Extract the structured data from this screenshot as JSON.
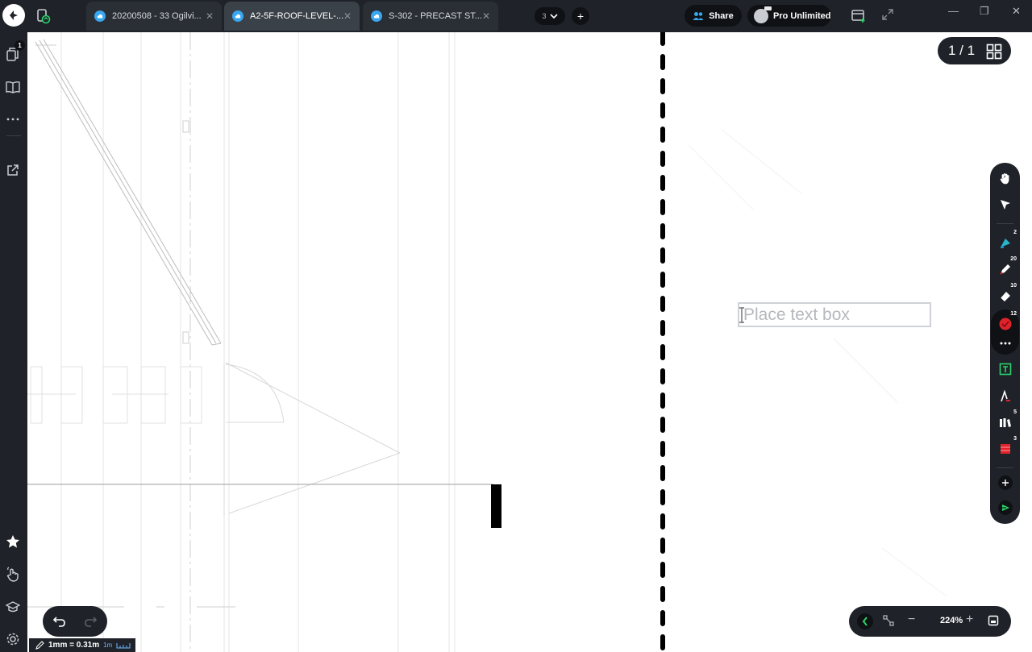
{
  "topbar": {
    "tabs": [
      {
        "label": "20200508 - 33 Ogilvi...",
        "active": false
      },
      {
        "label": "A2-5F-ROOF-LEVEL-...",
        "active": true
      },
      {
        "label": "S-302 - PRECAST ST...",
        "active": false
      }
    ],
    "tab_count": "3",
    "share_label": "Share",
    "pro_label": "Pro Unlimited",
    "window_controls": [
      "—",
      "❐",
      "✕"
    ]
  },
  "sidebar": {
    "pages_badge": "1",
    "items": [
      "pages-icon",
      "book-icon",
      "more-icon",
      "external-link-icon",
      "star-icon",
      "hand-gesture-icon",
      "graduation-cap-icon",
      "settings-icon"
    ]
  },
  "canvas": {
    "page_indicator": "1 / 1",
    "textbox_placeholder": "Place text box"
  },
  "toolbar": {
    "tools": [
      {
        "name": "pan-hand-icon",
        "badge": ""
      },
      {
        "name": "select-arrow-icon",
        "badge": ""
      },
      {
        "name": "highlighter-icon",
        "badge": "2"
      },
      {
        "name": "pen-icon",
        "badge": "20"
      },
      {
        "name": "eraser-icon",
        "badge": "10"
      },
      {
        "name": "stamp-icon",
        "badge": "12"
      },
      {
        "name": "text-tool-icon",
        "badge": ""
      },
      {
        "name": "measure-icon",
        "badge": ""
      },
      {
        "name": "library-icon",
        "badge": "5"
      },
      {
        "name": "shape-icon",
        "badge": "3"
      }
    ]
  },
  "bottom": {
    "scale_text": "1mm = 0.31m",
    "scale_sub": "1m",
    "zoom_level": "224%",
    "zoom_minus": "−",
    "zoom_plus": "+"
  },
  "colors": {
    "chrome": "#1f2329",
    "chrome_dark": "#0f1114",
    "accent_blue": "#39a7f0",
    "accent_green": "#2bd36b",
    "accent_red": "#e0232b"
  }
}
